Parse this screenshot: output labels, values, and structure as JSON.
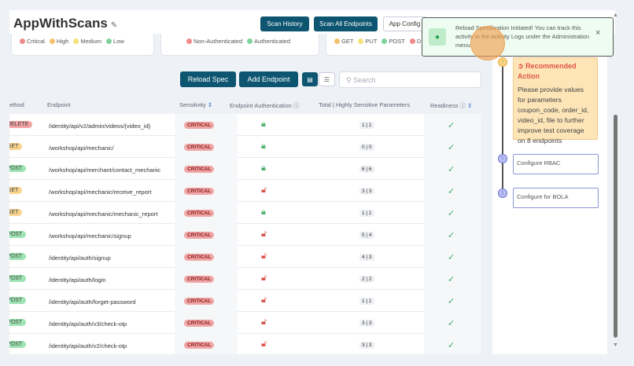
{
  "header": {
    "title": "AppWithScans",
    "edit_icon": "pencil-icon",
    "buttons": {
      "scan_history": "Scan History",
      "scan_all": "Scan All Endpoints",
      "app_config": "App Config"
    }
  },
  "legends": {
    "sensitivity": [
      {
        "label": "Critical",
        "color": "#f08a8a"
      },
      {
        "label": "High",
        "color": "#f4c06b"
      },
      {
        "label": "Medium",
        "color": "#f5e27a"
      },
      {
        "label": "Low",
        "color": "#7fd39a"
      }
    ],
    "auth": [
      {
        "label": "Non-Authenticated",
        "color": "#f08a8a"
      },
      {
        "label": "Authenticated",
        "color": "#7fd39a"
      }
    ],
    "methods": [
      {
        "label": "GET",
        "color": "#f4c06b"
      },
      {
        "label": "PUT",
        "color": "#f5e27a"
      },
      {
        "label": "POST",
        "color": "#7fd39a"
      },
      {
        "label": "D",
        "color": "#f08a8a"
      }
    ]
  },
  "toolbar": {
    "reload_spec": "Reload Spec",
    "add_endpoint": "Add Endpoint",
    "search_placeholder": "Search"
  },
  "table": {
    "headers": {
      "method": "ethod",
      "endpoint": "Endpoint",
      "sensitivity": "Sensitivity",
      "auth": "Endpoint Authentication",
      "params": "Total | Highly Sensitive Parameters",
      "readiness": "Readiness"
    },
    "rows": [
      {
        "method": "DELETE",
        "endpoint": "/identity/api/v2/admin/videos/{video_id}",
        "sensitivity": "CRITICAL",
        "authenticated": true,
        "params": "1 | 1",
        "ready": true
      },
      {
        "method": "GET",
        "endpoint": "/workshop/api/mechanic/",
        "sensitivity": "CRITICAL",
        "authenticated": true,
        "params": "0 | 0",
        "ready": true
      },
      {
        "method": "POST",
        "endpoint": "/workshop/api/merchant/contact_mechanic",
        "sensitivity": "CRITICAL",
        "authenticated": true,
        "params": "6 | 6",
        "ready": true
      },
      {
        "method": "GET",
        "endpoint": "/workshop/api/mechanic/receive_report",
        "sensitivity": "CRITICAL",
        "authenticated": false,
        "params": "3 | 3",
        "ready": true
      },
      {
        "method": "GET",
        "endpoint": "/workshop/api/mechanic/mechanic_report",
        "sensitivity": "CRITICAL",
        "authenticated": true,
        "params": "1 | 1",
        "ready": true
      },
      {
        "method": "POST",
        "endpoint": "/workshop/api/mechanic/signup",
        "sensitivity": "CRITICAL",
        "authenticated": false,
        "params": "5 | 4",
        "ready": true
      },
      {
        "method": "POST",
        "endpoint": "/identity/api/auth/signup",
        "sensitivity": "CRITICAL",
        "authenticated": false,
        "params": "4 | 3",
        "ready": true
      },
      {
        "method": "POST",
        "endpoint": "/identity/api/auth/login",
        "sensitivity": "CRITICAL",
        "authenticated": false,
        "params": "2 | 2",
        "ready": true
      },
      {
        "method": "POST",
        "endpoint": "/identity/api/auth/forget-password",
        "sensitivity": "CRITICAL",
        "authenticated": false,
        "params": "1 | 1",
        "ready": true
      },
      {
        "method": "POST",
        "endpoint": "/identity/api/auth/v3/check-otp",
        "sensitivity": "CRITICAL",
        "authenticated": false,
        "params": "3 | 3",
        "ready": true
      },
      {
        "method": "POST",
        "endpoint": "/identity/api/auth/v2/check-otp",
        "sensitivity": "CRITICAL",
        "authenticated": false,
        "params": "3 | 3",
        "ready": true
      }
    ]
  },
  "method_colors": {
    "DELETE": "#f4a3a3",
    "GET": "#f8d48f",
    "POST": "#9ee3b2"
  },
  "panel": {
    "recommended_title": "Recommended Action",
    "recommended_text": "Please provide values for parameters coupon_code, order_id, video_id, file to further improve test coverage on 8 endpoints",
    "configure_rbac": "Configure RBAC",
    "configure_bola": "Configure for BOLA"
  },
  "toast": {
    "message": "Reload Specification Initiated! You can track this activity in the Activity Logs under the Administration menu.",
    "close": "×"
  }
}
